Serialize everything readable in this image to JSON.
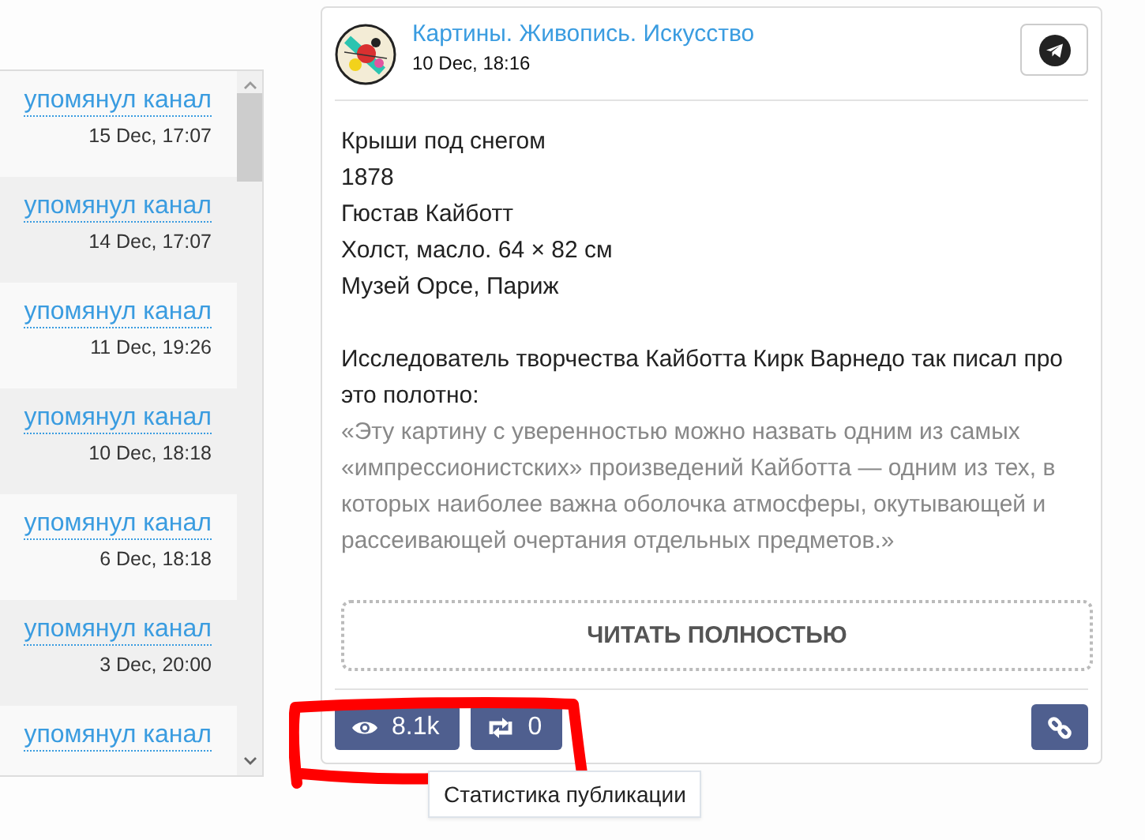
{
  "mentions": [
    {
      "link": "упомянул канал",
      "date": "15 Dec, 17:07"
    },
    {
      "link": "упомянул канал",
      "date": "14 Dec, 17:07"
    },
    {
      "link": "упомянул канал",
      "date": "11 Dec, 19:26"
    },
    {
      "link": "упомянул канал",
      "date": "10 Dec, 18:18"
    },
    {
      "link": "упомянул канал",
      "date": "6 Dec, 18:18"
    },
    {
      "link": "упомянул канал",
      "date": "3 Dec, 20:00"
    },
    {
      "link": "упомянул канал"
    }
  ],
  "post": {
    "channel": "Картины. Живопись. Искусство",
    "date": "10 Dec, 18:16",
    "lines": [
      "Крыши под снегом",
      "1878",
      "Гюстав Кайботт",
      "Холст, масло. 64 × 82 см",
      "Музей Орсе, Париж"
    ],
    "paragraph": "Исследователь творчества Кайботта Кирк Варнедо так писал про это полотно:",
    "quote": "«Эту картину с уверенностью можно назвать одним из самых «импрессионистских» произведений Кайботта — одним из тех, в которых наиболее важна оболочка атмосферы, окутывающей и рассеивающей очертания отдельных предметов.»",
    "read_more": "ЧИТАТЬ ПОЛНОСТЬЮ",
    "stats": [
      {
        "kind": "views",
        "value": "8.1k"
      },
      {
        "kind": "reposts",
        "value": "0"
      }
    ],
    "tooltip": "Статистика публикации"
  }
}
